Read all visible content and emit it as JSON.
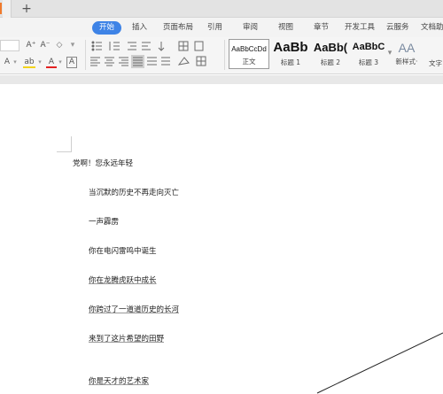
{
  "tabs": {
    "new_tab": "+"
  },
  "menu": {
    "items": [
      "开始",
      "插入",
      "页面布局",
      "引用",
      "审阅",
      "视图",
      "章节",
      "开发工具",
      "云服务",
      "文档助"
    ]
  },
  "toolbar": {
    "font_grow": "A⁺",
    "font_shrink": "A⁻",
    "clear_format": "◇",
    "text_effect": "A",
    "highlight": "ab",
    "font_color": "A",
    "char_border": "A",
    "styles": [
      {
        "preview": "AaBbCcDd",
        "name": "正文"
      },
      {
        "preview": "AaBb",
        "name": "标题 1"
      },
      {
        "preview": "AaBb(",
        "name": "标题 2"
      },
      {
        "preview": "AaBbC",
        "name": "标题 3"
      }
    ],
    "new_style_label": "新样式·",
    "text_tool_label": "文字"
  },
  "document": {
    "lines": [
      "党啊！您永远年轻",
      "当沉默的历史不再走向灭亡",
      "一声霹雳",
      "你在电闪雷鸣中诞生",
      "你在龙腾虎跃中成长",
      "你跨过了一道道历史的长河",
      "来到了这片希望的田野",
      "你是天才的艺术家"
    ]
  }
}
